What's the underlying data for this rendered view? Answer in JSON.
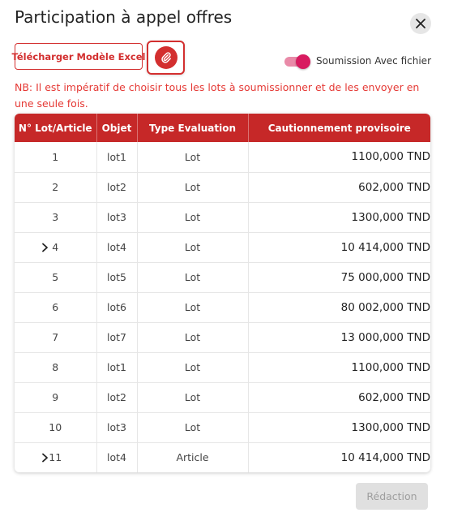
{
  "dialog": {
    "title": "Participation à appel offres"
  },
  "toolbar": {
    "excel_label": "Télécharger Modèle Excel",
    "toggle_label": "Soumission Avec fichier",
    "toggle_on": true
  },
  "notice": "NB: Il est impératif de choisir tous les lots à soumissionner et de les envoyer en une seule fois.",
  "table": {
    "headers": [
      "N° Lot/Article",
      "Objet",
      "Type Evaluation",
      "Cautionnement provisoire"
    ],
    "rows": [
      {
        "num": "1",
        "objet": "lot1",
        "type": "Lot",
        "amount": "1100,000 TND",
        "expandable": false
      },
      {
        "num": "2",
        "objet": "lot2",
        "type": "Lot",
        "amount": "602,000 TND",
        "expandable": false
      },
      {
        "num": "3",
        "objet": "lot3",
        "type": "Lot",
        "amount": "1300,000 TND",
        "expandable": false
      },
      {
        "num": "4",
        "objet": "lot4",
        "type": "Lot",
        "amount": "10 414,000 TND",
        "expandable": true
      },
      {
        "num": "5",
        "objet": "lot5",
        "type": "Lot",
        "amount": "75 000,000 TND",
        "expandable": false
      },
      {
        "num": "6",
        "objet": "lot6",
        "type": "Lot",
        "amount": "80 002,000 TND",
        "expandable": false
      },
      {
        "num": "7",
        "objet": "lot7",
        "type": "Lot",
        "amount": "13 000,000 TND",
        "expandable": false
      },
      {
        "num": "8",
        "objet": "lot1",
        "type": "Lot",
        "amount": "1100,000 TND",
        "expandable": false
      },
      {
        "num": "9",
        "objet": "lot2",
        "type": "Lot",
        "amount": "602,000 TND",
        "expandable": false
      },
      {
        "num": "10",
        "objet": "lot3",
        "type": "Lot",
        "amount": "1300,000 TND",
        "expandable": false
      },
      {
        "num": "11",
        "objet": "lot4",
        "type": "Article",
        "amount": "10 414,000 TND",
        "expandable": true
      }
    ]
  },
  "footer": {
    "redaction_label": "Rédaction"
  },
  "colors": {
    "accent": "#c62828",
    "notice": "#e53935",
    "toggle": "#d81b60"
  },
  "icons": {
    "close": "close-icon",
    "attach": "paperclip-icon",
    "expand": "chevron-right-icon"
  }
}
